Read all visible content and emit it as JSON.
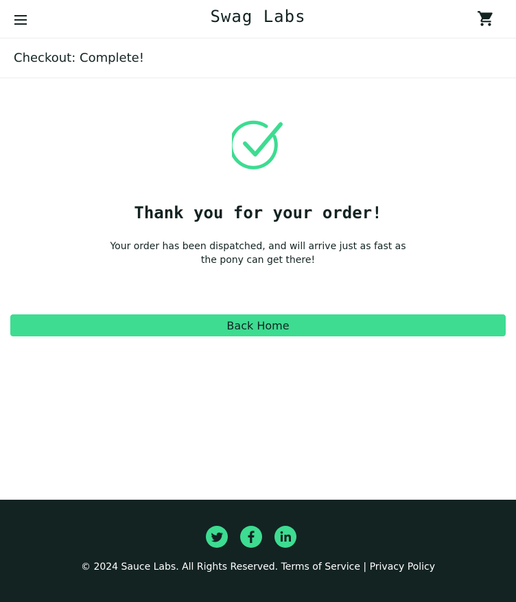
{
  "header": {
    "app_logo": "Swag Labs",
    "menu_icon": "hamburger-menu-icon",
    "cart_icon": "shopping-cart-icon"
  },
  "subheader": {
    "title": "Checkout: Complete!"
  },
  "complete": {
    "icon": "checkmark-circle-icon",
    "header": "Thank you for your order!",
    "text": "Your order has been dispatched, and will arrive just as fast as the pony can get there!",
    "back_home_label": "Back Home"
  },
  "footer": {
    "social": [
      {
        "name": "twitter",
        "icon": "twitter-icon"
      },
      {
        "name": "facebook",
        "icon": "facebook-icon"
      },
      {
        "name": "linkedin",
        "icon": "linkedin-icon"
      }
    ],
    "copyright": "© 2024 Sauce Labs. All Rights Reserved.",
    "terms_label": "Terms of Service",
    "separator": "|",
    "privacy_label": "Privacy Policy"
  },
  "colors": {
    "accent": "#3ddc91",
    "text": "#132322",
    "footer_bg": "#132322",
    "divider": "#ededed"
  }
}
